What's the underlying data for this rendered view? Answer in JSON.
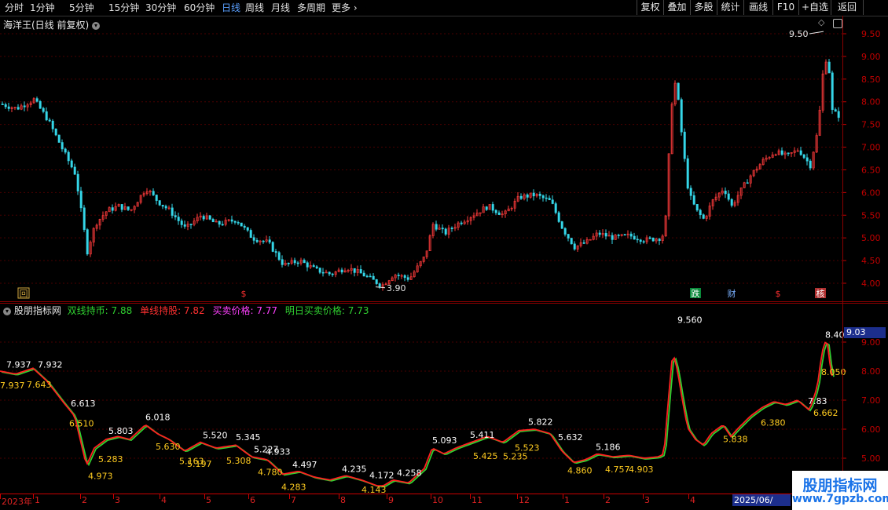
{
  "toolbar": {
    "timeframes": [
      "分时",
      "1分钟",
      "5分钟",
      "15分钟",
      "30分钟",
      "60分钟",
      "日线",
      "周线",
      "月线",
      "多周期",
      "更多"
    ],
    "active": "日线",
    "more_chevron": "›",
    "right_buttons": [
      "复权",
      "叠加",
      "多股",
      "统计",
      "画线",
      "F10",
      "+自选",
      "返回"
    ]
  },
  "main_panel": {
    "title": "海洋王(日线 前复权)",
    "y_ticks": [
      "9.50",
      "9.00",
      "8.50",
      "8.00",
      "7.50",
      "7.00",
      "6.50",
      "6.00",
      "5.50",
      "5.00",
      "4.50",
      "4.00"
    ],
    "high_label": "9.50",
    "low_label": "3.90",
    "markers": [
      {
        "text": "回",
        "color": "#d4aa40",
        "box": true
      },
      {
        "text": "$",
        "color": "#ff3030"
      },
      {
        "text": "跌",
        "color": "#ffffff",
        "bg": "#0a8a3a"
      },
      {
        "text": "财",
        "color": "#7ab0ff"
      },
      {
        "text": "$",
        "color": "#ff3030"
      },
      {
        "text": "核",
        "color": "#ffffff",
        "bg": "#b03030"
      }
    ]
  },
  "indicator_panel": {
    "title": "股朋指标网",
    "legend": [
      {
        "label": "双线持币: 7.88",
        "color": "#30d030"
      },
      {
        "label": "单线持股: 7.82",
        "color": "#ff3030"
      },
      {
        "label": "买卖价格: 7.77",
        "color": "#ff40ff"
      },
      {
        "label": "明日买卖价格: 7.73",
        "color": "#30d030"
      }
    ],
    "y_ticks": [
      "9.00",
      "8.00",
      "7.00",
      "6.00",
      "5.00"
    ],
    "current_value": "9.03",
    "peak_label": "9.560",
    "labels_white": [
      "7.937",
      "7.932",
      "6.613",
      "5.803",
      "6.018",
      "5.520",
      "5.345",
      "5.227",
      "4.933",
      "4.497",
      "4.235",
      "4.172",
      "4.258",
      "5.093",
      "5.411",
      "5.822",
      "5.632",
      "5.186",
      "8.40",
      "7.83"
    ],
    "labels_yellow": [
      "7.937",
      "7.643",
      "6.510",
      "5.283",
      "4.973",
      "5.630",
      "5.197",
      "5.163",
      "5.308",
      "4.780",
      "4.283",
      "4.143",
      "5.425",
      "5.235",
      "5.523",
      "4.860",
      "4.757",
      "4.903",
      "5.838",
      "6.380",
      "6.662",
      "8.050"
    ]
  },
  "x_axis": {
    "labels": [
      "2023年",
      "1",
      "2",
      "3",
      "4",
      "5",
      "6",
      "7",
      "8",
      "9",
      "10",
      "11",
      "12",
      "1",
      "2",
      "3",
      "4"
    ],
    "highlight": "2025/06/"
  },
  "watermark": {
    "title": "股朋指标网",
    "url": "www.7gpzb.com"
  },
  "colors": {
    "up": "#ff3b3b",
    "down": "#35d6e8",
    "grid": "#5a0000",
    "axis": "#c00000"
  }
}
